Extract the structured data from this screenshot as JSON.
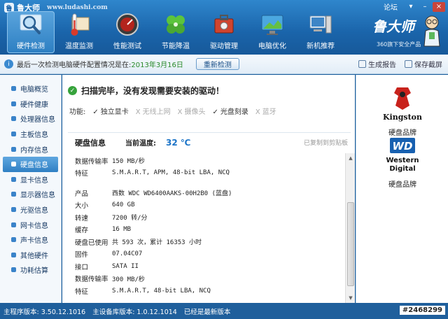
{
  "window": {
    "app_name": "鲁大师",
    "url": "www.ludashi.com",
    "forum": "论坛",
    "minimize": "–",
    "close": "×"
  },
  "nav": [
    {
      "label": "硬件检测",
      "icon": "magnifier-icon"
    },
    {
      "label": "温度监测",
      "icon": "thermometer-icon"
    },
    {
      "label": "性能测试",
      "icon": "speedometer-icon"
    },
    {
      "label": "节能降温",
      "icon": "clover-icon"
    },
    {
      "label": "驱动管理",
      "icon": "toolbox-icon"
    },
    {
      "label": "电脑优化",
      "icon": "monitor-icon"
    },
    {
      "label": "新机推荐",
      "icon": "computer-icon"
    }
  ],
  "brand": {
    "logo_text": "鲁大师",
    "subtitle": "360旗下安全产品"
  },
  "strip": {
    "message": "最后一次检测电脑硬件配置情况是在:",
    "date": "2013年3月16日",
    "recheck": "重新检测",
    "report": "生成报告",
    "screenshot": "保存截屏"
  },
  "sidebar": [
    {
      "label": "电脑概览",
      "active": false
    },
    {
      "label": "硬件健康",
      "active": false
    },
    {
      "label": "处理器信息",
      "active": false
    },
    {
      "label": "主板信息",
      "active": false
    },
    {
      "label": "内存信息",
      "active": false
    },
    {
      "label": "硬盘信息",
      "active": true
    },
    {
      "label": "显卡信息",
      "active": false
    },
    {
      "label": "显示器信息",
      "active": false
    },
    {
      "label": "光驱信息",
      "active": false
    },
    {
      "label": "网卡信息",
      "active": false
    },
    {
      "label": "声卡信息",
      "active": false
    },
    {
      "label": "其他硬件",
      "active": false
    },
    {
      "label": "功耗估算",
      "active": false
    }
  ],
  "main": {
    "scan_result": "扫描完毕，没有发现需要安装的驱动！",
    "features_label": "功能:",
    "features": [
      {
        "mark": "✓",
        "label": "独立显卡",
        "on": true
      },
      {
        "mark": "X",
        "label": "无线上网",
        "on": false
      },
      {
        "mark": "X",
        "label": "摄像头",
        "on": false
      },
      {
        "mark": "✓",
        "label": "光盘刻录",
        "on": true
      },
      {
        "mark": "X",
        "label": "蓝牙",
        "on": false
      }
    ],
    "panel_title": "硬盘信息",
    "temp_label": "当前温度:",
    "temp_value": "32 ℃",
    "copied": "已复制到剪贴板",
    "rows_a": [
      {
        "k": "数据传输率",
        "v": "150 MB/秒"
      },
      {
        "k": "特征",
        "v": "S.M.A.R.T,  APM,  48-bit LBA,  NCQ"
      }
    ],
    "rows_b": [
      {
        "k": "产品",
        "v": "西数 WDC WD6400AAKS-00H2B0 (蓝盘)"
      },
      {
        "k": "大小",
        "v": "640 GB"
      },
      {
        "k": "转速",
        "v": "7200 转/分"
      },
      {
        "k": "缓存",
        "v": "16 MB"
      },
      {
        "k": "硬盘已使用",
        "v": "共 593 次，累计 16353 小时"
      },
      {
        "k": "固件",
        "v": "07.04C07"
      },
      {
        "k": "接口",
        "v": "SATA II"
      },
      {
        "k": "数据传输率",
        "v": "300 MB/秒"
      },
      {
        "k": "特征",
        "v": "S.M.A.R.T,  48-bit LBA,  NCQ"
      }
    ]
  },
  "brands": [
    {
      "name": "Kingston",
      "caption": "硬盘品牌"
    },
    {
      "name": "Western Digital",
      "caption": "硬盘品牌"
    }
  ],
  "status": {
    "main_version": "主程序版本: 3.50.12.1016",
    "db_version": "主设备库版本: 1.0.12.1014",
    "latest": "已经是最新版本",
    "tag": "#2468299"
  },
  "colors": {
    "accent": "#1a64aa",
    "ok": "#37a33c",
    "temp": "#1a73c7"
  }
}
